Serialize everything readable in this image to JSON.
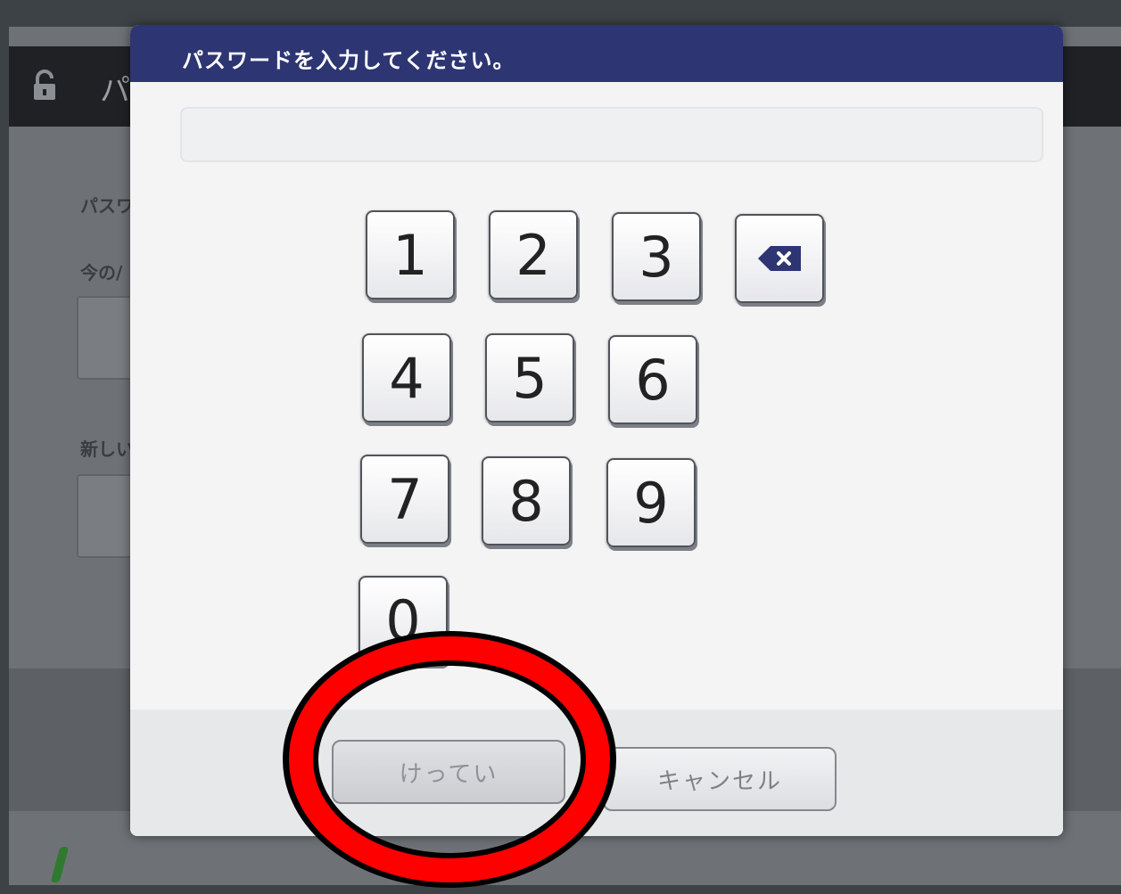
{
  "background": {
    "title_partial": "パス",
    "label_password_partial": "パスワ",
    "label_current_partial": "今の/",
    "label_new_partial": "新しい"
  },
  "dialog": {
    "title": "パスワードを入力してください。",
    "password_value": "",
    "keypad": {
      "keys": [
        "1",
        "2",
        "3",
        "4",
        "5",
        "6",
        "7",
        "8",
        "9",
        "0"
      ],
      "backspace_icon": "backspace-icon"
    },
    "ok_label": "けってい",
    "cancel_label": "キャンセル"
  },
  "annotation": {
    "shape": "red-ellipse",
    "color": "#ff0000",
    "target": "ok-button"
  },
  "colors": {
    "header": "#2e3573",
    "dialog_bg": "#f4f4f5",
    "overlay_bg": "#6e7276"
  }
}
